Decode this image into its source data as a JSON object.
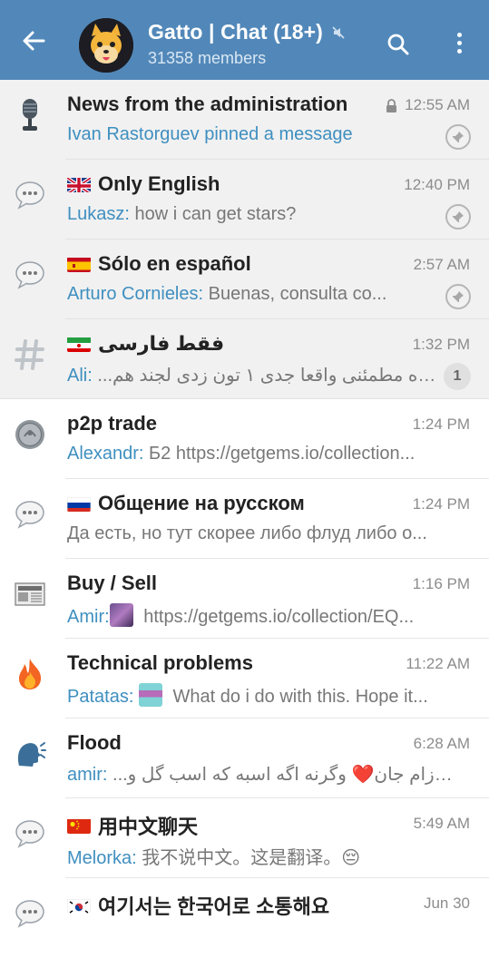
{
  "header": {
    "title": "Gatto | Chat (18+)",
    "members": "31358 members",
    "icons": [
      "back-arrow-icon",
      "muted-icon",
      "search-icon",
      "more-vertical-icon"
    ],
    "bar_color": "#5288b9"
  },
  "chats": [
    {
      "name": "News from the administration",
      "time": "12:55 AM",
      "locked": true,
      "sender": "Ivan Rastorguev pinned a message",
      "text": "",
      "pinned": true,
      "icon": "microphone-icon"
    },
    {
      "name": "Only English",
      "flag": "uk",
      "time": "12:40 PM",
      "sender": "Lukasz:",
      "text": " how i can get stars?",
      "pinned": true,
      "icon": "speech-bubble-icon"
    },
    {
      "name": "Sólo en español",
      "flag": "es",
      "time": "2:57 AM",
      "sender": "Arturo Cornieles:",
      "text": " Buenas, consulta co...",
      "pinned": true,
      "icon": "speech-bubble-icon"
    },
    {
      "name": "فقط فارسی",
      "flag": "ir",
      "time": "1:32 PM",
      "sender": "Ali:",
      "text": "کاوه مطمئنی واقعا جدی ۱ تون زدی لجند هم...",
      "unread": "1",
      "icon": "hashtag-icon"
    },
    {
      "name": "p2p trade",
      "time": "1:24 PM",
      "sender": "Alexandr:",
      "text": " Б2 https://getgems.io/collection...",
      "icon": "coin-icon"
    },
    {
      "name": "Общение на русском",
      "flag": "ru",
      "time": "1:24 PM",
      "sender": "",
      "text": "Да есть, но тут скорее либо флуд либо о...",
      "icon": "speech-bubble-icon"
    },
    {
      "name": "Buy / Sell",
      "time": "1:16 PM",
      "sender": "Amir:",
      "text": " https://getgems.io/collection/EQ...",
      "thumb": true,
      "icon": "newspaper-icon"
    },
    {
      "name": "Technical problems",
      "time": "11:22 AM",
      "sender": "Patatas:",
      "text": " What do i do with this. Hope it...",
      "thumb": true,
      "icon": "fire-icon"
    },
    {
      "name": "Flood",
      "time": "6:28 AM",
      "sender": "amir:",
      "text": "اره فرزام جان❤️ وگرنه اگه اسبه که اسب گل و...",
      "icon": "speaking-head-icon"
    },
    {
      "name": "用中文聊天",
      "flag": "cn",
      "time": "5:49 AM",
      "sender": "Melorka:",
      "text": " 我不说中文。这是翻译。😔",
      "icon": "speech-bubble-icon"
    },
    {
      "name": "여기서는 한국어로 소통해요",
      "flag": "kr",
      "time": "Jun 30",
      "sender": "",
      "text": "",
      "icon": "speech-bubble-icon"
    }
  ]
}
